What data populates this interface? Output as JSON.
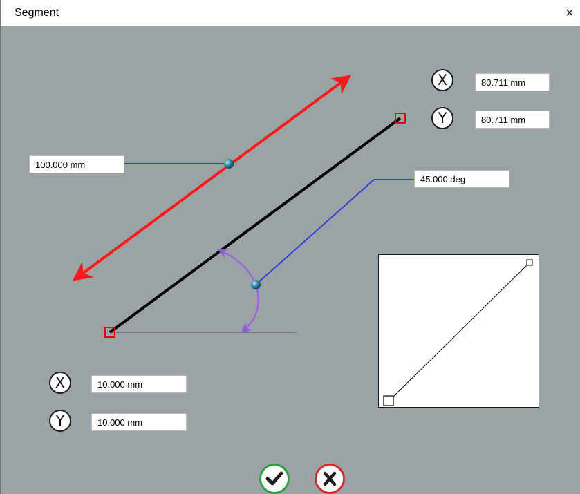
{
  "window": {
    "title": "Segment",
    "close_glyph": "×"
  },
  "length": {
    "value": "100.000 mm"
  },
  "angle": {
    "value": "45.000 deg"
  },
  "start_point": {
    "x_label": "X",
    "y_label": "Y",
    "x_value": "10.000 mm",
    "y_value": "10.000 mm"
  },
  "end_point": {
    "x_label": "X",
    "y_label": "Y",
    "x_value": "80.711 mm",
    "y_value": "80.711 mm"
  },
  "colors": {
    "background": "#9ca3a6",
    "segment": "#000000",
    "length_arrow": "#ff1a1a",
    "leader_line": "#2f3fe0",
    "angle_arc": "#9a66d9",
    "endpoint_marker": "#e60000",
    "ok_border": "#2f9e44",
    "cancel_border": "#d22d2d"
  },
  "icons": {
    "ok": "checkmark-icon",
    "cancel": "cross-icon",
    "close": "close-icon"
  }
}
